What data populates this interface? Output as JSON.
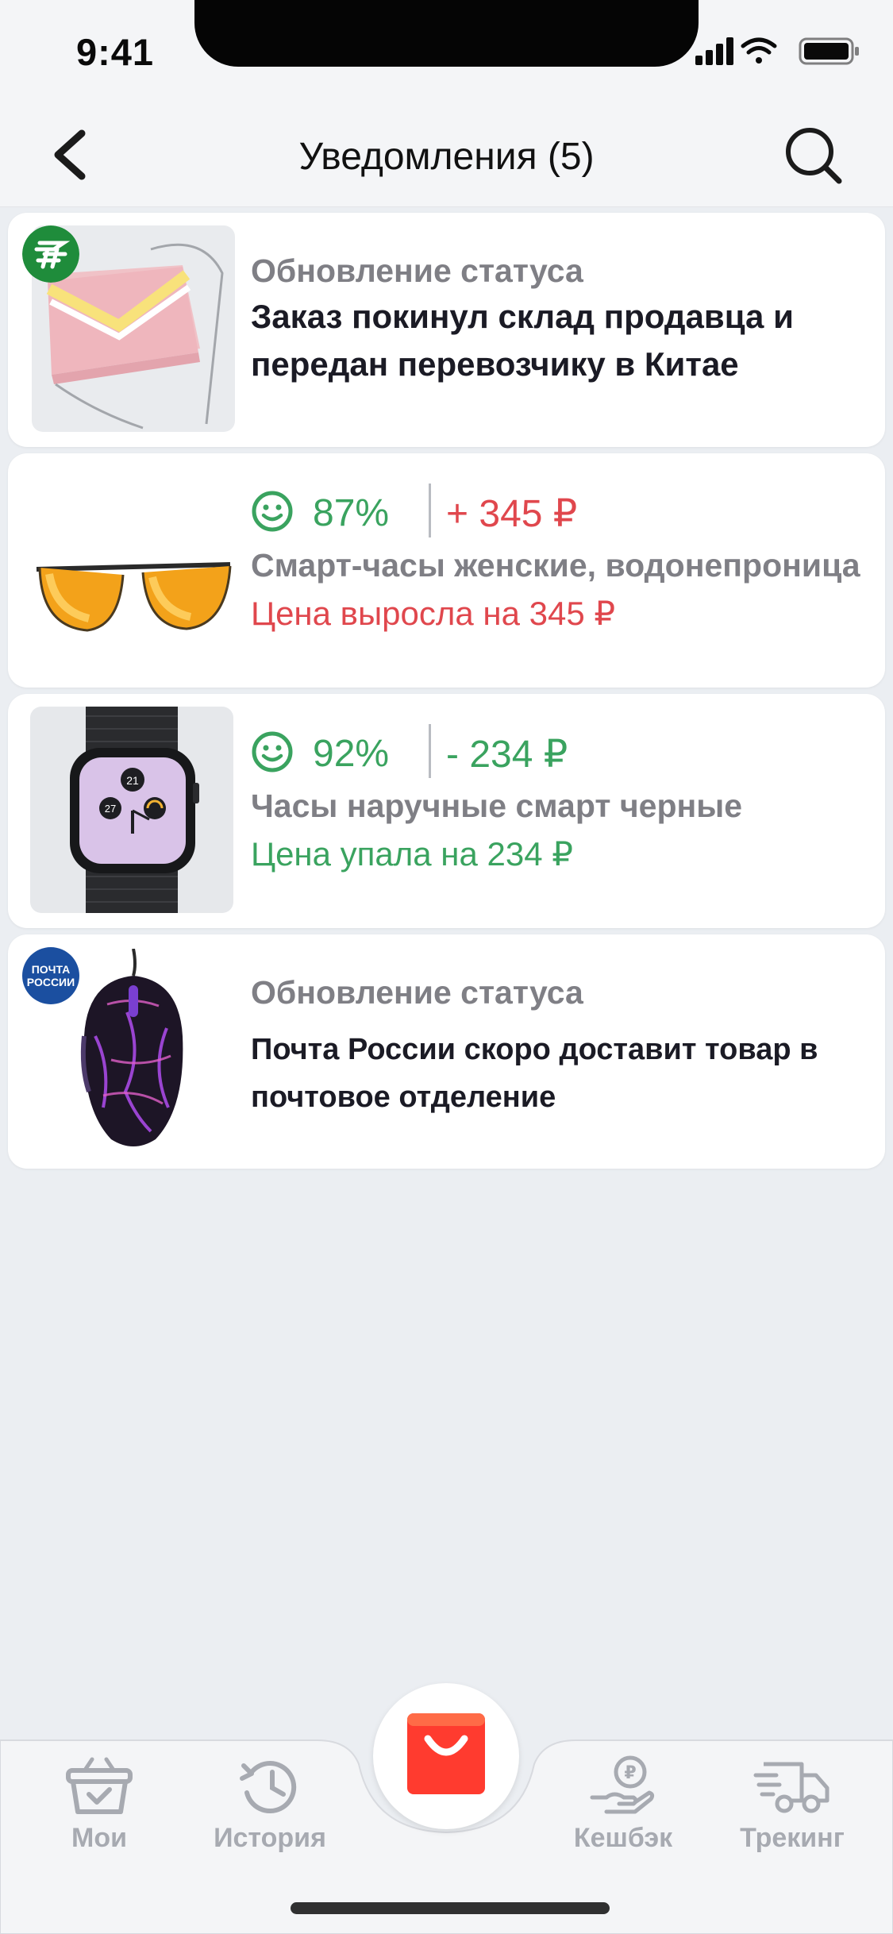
{
  "status_bar": {
    "time": "9:41"
  },
  "nav": {
    "title": "Уведомления (5)",
    "back_icon": "chevron-left-icon",
    "search_icon": "search-icon"
  },
  "notifications": [
    {
      "kind": "status",
      "badge": "china-post-logo",
      "product_image": "pink-handbag",
      "title": "Обновление статуса",
      "message": "Заказ покинул склад продавца и передан перевозчику в Китае"
    },
    {
      "kind": "price",
      "product_image": "orange-sunglasses",
      "rating": "87%",
      "delta": "+ 345 ₽",
      "delta_color": "#e0474d",
      "product": "Смарт-часы женские, водонепроницаемые",
      "note": "Цена выросла на 345 ₽"
    },
    {
      "kind": "price",
      "product_image": "smart-watch",
      "rating": "92%",
      "delta": "- 234 ₽",
      "delta_color": "#3aa35f",
      "product": "Часы наручные смарт черные",
      "note": "Цена упала на 234 ₽",
      "watch_digits": [
        "21",
        "27"
      ]
    },
    {
      "kind": "status",
      "badge": "russian-post-logo",
      "badge_text": [
        "ПОЧТА",
        "РОССИИ"
      ],
      "product_image": "gaming-mouse",
      "title": "Обновление статуса",
      "message": "Почта России скоро доставит товар в почтовое отделение"
    }
  ],
  "tabs": [
    {
      "label": "Мои",
      "icon": "basket-icon"
    },
    {
      "label": "История",
      "icon": "history-icon"
    },
    {
      "label": "",
      "icon": "aliexpress-bag-icon"
    },
    {
      "label": "Кешбэк",
      "icon": "cashback-icon"
    },
    {
      "label": "Трекинг",
      "icon": "truck-icon"
    }
  ],
  "colors": {
    "green": "#3aa35f",
    "red": "#e0474d",
    "accent": "#ff3b2f"
  }
}
